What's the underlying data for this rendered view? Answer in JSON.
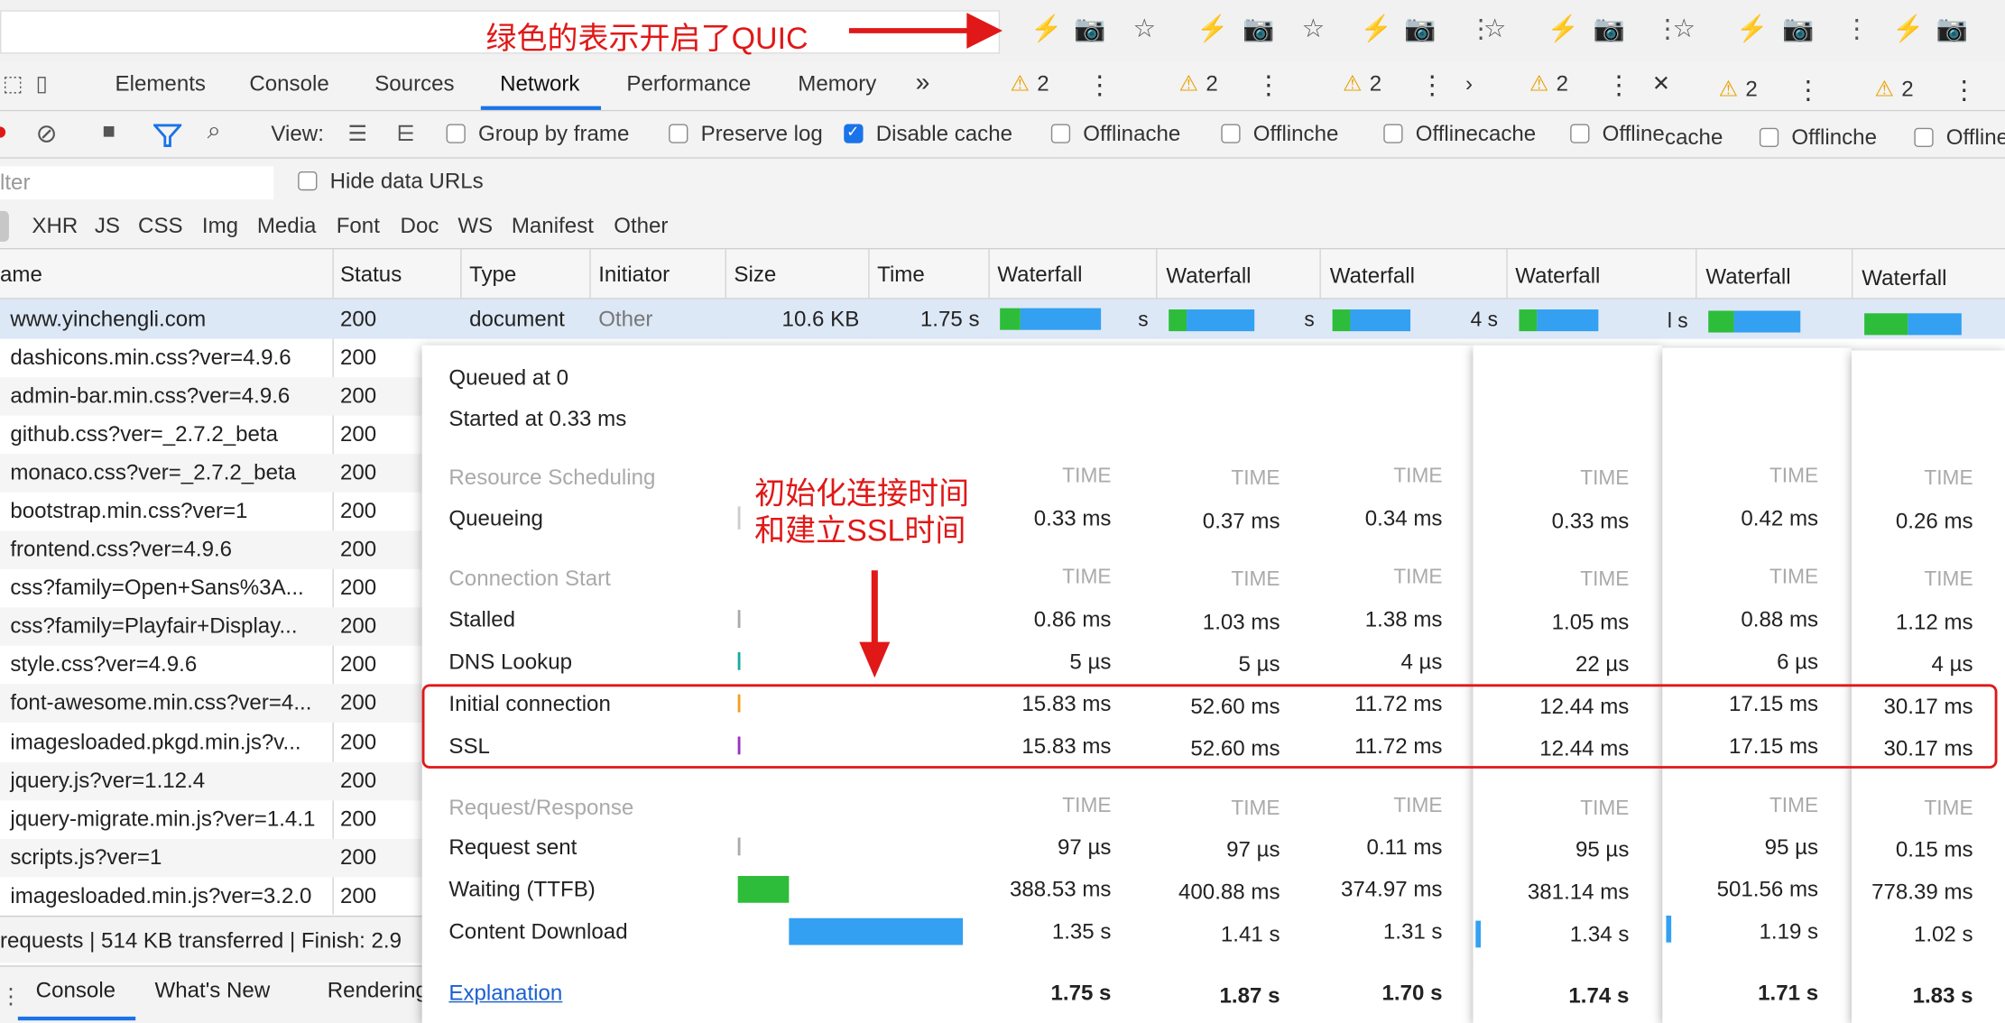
{
  "annotations": {
    "quic_note": "绿色的表示开启了QUIC",
    "conn_note_line1": "初始化连接时间",
    "conn_note_line2": "和建立SSL时间"
  },
  "browser": {
    "icons": [
      "bolt-icon",
      "camera-icon",
      "star-icon",
      "menu-dots-icon"
    ],
    "bolt_color": "#2dbd3a"
  },
  "devtools": {
    "tabs": [
      "Elements",
      "Console",
      "Sources",
      "Network",
      "Performance",
      "Memory"
    ],
    "more": "»",
    "active_tab": "Network",
    "warning_count": "2",
    "toolbar": {
      "view_label": "View:",
      "group_by_frame": "Group by frame",
      "preserve_log": "Preserve log",
      "disable_cache": "Disable cache",
      "offline": "Offline",
      "clipped_1": "Offlinache",
      "clipped_2": "Offlinche",
      "clipped_3": "Offlinecache",
      "clipped_4": "Offline",
      "clipped_5": "cache"
    },
    "filter": {
      "placeholder_partial": "lter",
      "hide_data_urls": "Hide data URLs"
    },
    "types": [
      "XHR",
      "JS",
      "CSS",
      "Img",
      "Media",
      "Font",
      "Doc",
      "WS",
      "Manifest",
      "Other"
    ],
    "columns": {
      "name": "ame",
      "status": "Status",
      "type": "Type",
      "initiator": "Initiator",
      "size": "Size",
      "time": "Time",
      "waterfall": "Waterfall"
    },
    "selected_row": {
      "name": "www.yinchengli.com",
      "status": "200",
      "type": "document",
      "initiator": "Other",
      "size": "10.6 KB",
      "time": "1.75 s"
    },
    "rows": [
      {
        "name": "dashicons.min.css?ver=4.9.6",
        "status": "200"
      },
      {
        "name": "admin-bar.min.css?ver=4.9.6",
        "status": "200"
      },
      {
        "name": "github.css?ver=_2.7.2_beta",
        "status": "200"
      },
      {
        "name": "monaco.css?ver=_2.7.2_beta",
        "status": "200"
      },
      {
        "name": "bootstrap.min.css?ver=1",
        "status": "200"
      },
      {
        "name": "frontend.css?ver=4.9.6",
        "status": "200"
      },
      {
        "name": "css?family=Open+Sans%3A...",
        "status": "200"
      },
      {
        "name": "css?family=Playfair+Display...",
        "status": "200"
      },
      {
        "name": "style.css?ver=4.9.6",
        "status": "200"
      },
      {
        "name": "font-awesome.min.css?ver=4...",
        "status": "200"
      },
      {
        "name": "imagesloaded.pkgd.min.js?v...",
        "status": "200"
      },
      {
        "name": "jquery.js?ver=1.12.4",
        "status": "200"
      },
      {
        "name": "jquery-migrate.min.js?ver=1.4.1",
        "status": "200"
      },
      {
        "name": "scripts.js?ver=1",
        "status": "200"
      },
      {
        "name": "imagesloaded.min.js?ver=3.2.0",
        "status": "200"
      }
    ],
    "status_bar": "requests | 514 KB transferred | Finish: 2.9",
    "drawer_tabs": [
      "Console",
      "What's New",
      "Rendering"
    ],
    "clip_marks": [
      "s",
      "s",
      "s",
      "4 s",
      "l s"
    ]
  },
  "timing": {
    "queued": "Queued at 0",
    "started": "Started at 0.33 ms",
    "time_header": "TIME",
    "sections": {
      "scheduling": "Resource Scheduling",
      "connection": "Connection Start",
      "request": "Request/Response"
    },
    "labels": {
      "queueing": "Queueing",
      "stalled": "Stalled",
      "dns": "DNS Lookup",
      "initial": "Initial connection",
      "ssl": "SSL",
      "sent": "Request sent",
      "waiting": "Waiting (TTFB)",
      "download": "Content Download"
    },
    "explanation": "Explanation",
    "columns": [
      {
        "queueing": "0.33 ms",
        "stalled": "0.86 ms",
        "dns": "5 µs",
        "initial": "15.83 ms",
        "ssl": "15.83 ms",
        "sent": "97 µs",
        "waiting": "388.53 ms",
        "download": "1.35 s",
        "total": "1.75 s"
      },
      {
        "queueing": "0.37 ms",
        "stalled": "1.03 ms",
        "dns": "5 µs",
        "initial": "52.60 ms",
        "ssl": "52.60 ms",
        "sent": "97 µs",
        "waiting": "400.88 ms",
        "download": "1.41 s",
        "total": "1.87 s"
      },
      {
        "queueing": "0.34 ms",
        "stalled": "1.38 ms",
        "dns": "4 µs",
        "initial": "11.72 ms",
        "ssl": "11.72 ms",
        "sent": "0.11 ms",
        "waiting": "374.97 ms",
        "download": "1.31 s",
        "total": "1.70 s"
      },
      {
        "queueing": "0.33 ms",
        "stalled": "1.05 ms",
        "dns": "22 µs",
        "initial": "12.44 ms",
        "ssl": "12.44 ms",
        "sent": "95 µs",
        "waiting": "381.14 ms",
        "download": "1.34 s",
        "total": "1.74 s"
      },
      {
        "queueing": "0.42 ms",
        "stalled": "0.88 ms",
        "dns": "6 µs",
        "initial": "17.15 ms",
        "ssl": "17.15 ms",
        "sent": "95 µs",
        "waiting": "501.56 ms",
        "download": "1.19 s",
        "total": "1.71 s"
      },
      {
        "queueing": "0.26 ms",
        "stalled": "1.12 ms",
        "dns": "4 µs",
        "initial": "30.17 ms",
        "ssl": "30.17 ms",
        "sent": "0.15 ms",
        "waiting": "778.39 ms",
        "download": "1.02 s",
        "total": "1.83 s"
      }
    ]
  }
}
